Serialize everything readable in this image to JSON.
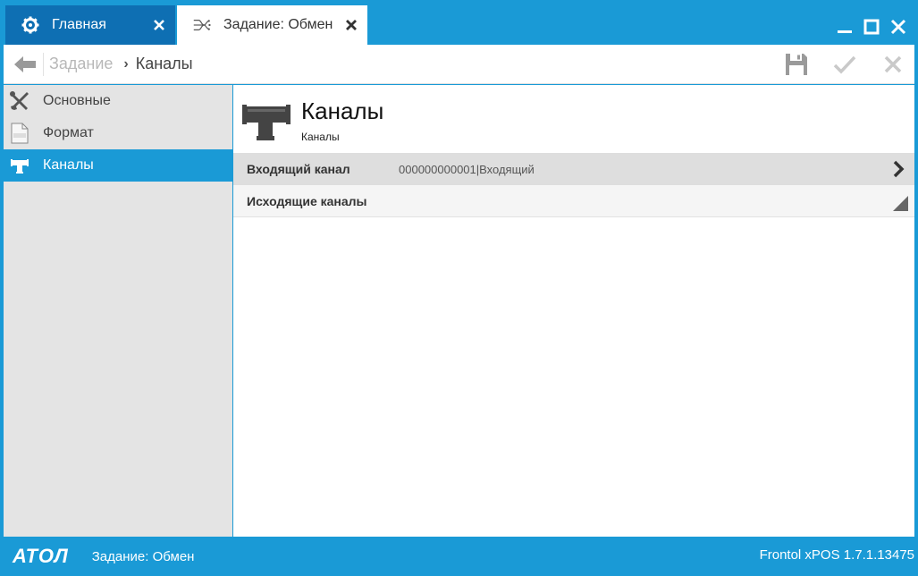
{
  "tabs": {
    "home": {
      "label": "Главная",
      "icon": "gear-icon"
    },
    "task": {
      "label": "Задание: Обмен",
      "icon": "exchange-icon"
    }
  },
  "window_controls": [
    "minimize-icon",
    "maximize-icon",
    "close-icon"
  ],
  "toolbar": {
    "breadcrumb": {
      "parent": "Задание",
      "current": "Каналы"
    },
    "actions": [
      "save-icon",
      "checkmark-icon",
      "cancel-icon"
    ]
  },
  "sidebar": {
    "items": [
      {
        "label": "Основные",
        "icon": "tools-icon",
        "active": false
      },
      {
        "label": "Формат",
        "icon": "data-file-icon",
        "active": false
      },
      {
        "label": "Каналы",
        "icon": "channel-pipe-icon",
        "active": true
      }
    ]
  },
  "main": {
    "title": "Каналы",
    "subtitle": "Каналы",
    "rows": [
      {
        "label": "Входящий канал",
        "value": "000000000001|Входящий"
      },
      {
        "label": "Исходящие каналы",
        "value": ""
      }
    ]
  },
  "status": {
    "logo": "АТОЛ",
    "text": "Задание: Обмен",
    "version": "Frontol xPOS 1.7.1.13475"
  },
  "colors": {
    "accent": "#1a9ad6",
    "tab_dark": "#0e6fb3",
    "sidebar_bg": "#e4e4e4"
  }
}
